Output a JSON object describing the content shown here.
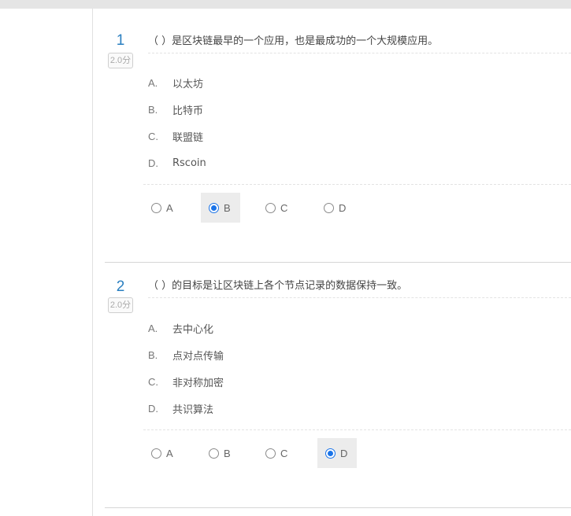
{
  "questions": [
    {
      "number": "1",
      "score": "2.0分",
      "text": "（ ）是区块链最早的一个应用，也是最成功的一个大规模应用。",
      "options": [
        {
          "letter": "A.",
          "text": "以太坊"
        },
        {
          "letter": "B.",
          "text": "比特币"
        },
        {
          "letter": "C.",
          "text": "联盟链"
        },
        {
          "letter": "D.",
          "text": "Rscoin"
        }
      ],
      "choices": [
        "A",
        "B",
        "C",
        "D"
      ],
      "selected": "B"
    },
    {
      "number": "2",
      "score": "2.0分",
      "text": "（ ）的目标是让区块链上各个节点记录的数据保持一致。",
      "options": [
        {
          "letter": "A.",
          "text": "去中心化"
        },
        {
          "letter": "B.",
          "text": "点对点传输"
        },
        {
          "letter": "C.",
          "text": "非对称加密"
        },
        {
          "letter": "D.",
          "text": "共识算法"
        }
      ],
      "choices": [
        "A",
        "B",
        "C",
        "D"
      ],
      "selected": "D"
    }
  ],
  "colors": {
    "number": "#2a7fc0",
    "radio_selected": "#1a73e8",
    "selected_bg": "#ececec"
  }
}
